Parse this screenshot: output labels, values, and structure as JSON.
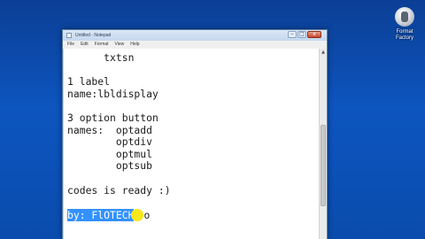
{
  "desktop": {
    "icon_name": "format-factory-icon",
    "icon_label_line1": "Format",
    "icon_label_line2": "Factory"
  },
  "window": {
    "title": "Untitled - Notepad",
    "menu": [
      "File",
      "Edit",
      "Format",
      "View",
      "Help"
    ],
    "controls": {
      "minimize": "–",
      "maximize": "□",
      "close": "x"
    },
    "scroll_up": "▲"
  },
  "editor": {
    "lines": [
      "      txtsn",
      "",
      "1 label",
      "name:lbldisplay",
      "",
      "3 option button",
      "names:  optadd",
      "        optdiv",
      "        optmul",
      "        optsub",
      "",
      "codes is ready :)",
      ""
    ],
    "selected_line": "by: FlOTECH",
    "trailing_char": "o"
  },
  "colors": {
    "desktop": "#0d55bf",
    "selection": "#3391ff",
    "cursor_highlight": "#f7e81b"
  }
}
